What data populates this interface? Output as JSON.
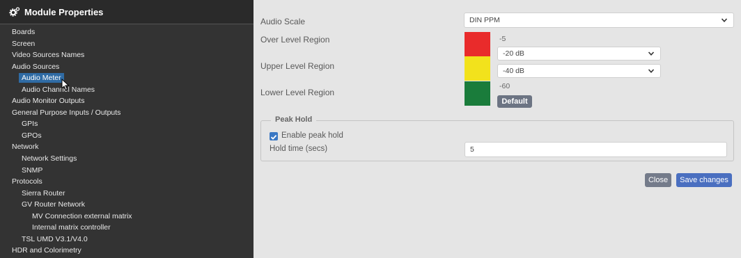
{
  "sidebar": {
    "title": "Module Properties",
    "items": [
      {
        "label": "Boards"
      },
      {
        "label": "Screen"
      },
      {
        "label": "Video Sources Names"
      },
      {
        "label": "Audio Sources"
      },
      {
        "label": "Audio Meter",
        "selected": true
      },
      {
        "label": "Audio Channel Names"
      },
      {
        "label": "Audio Monitor Outputs"
      },
      {
        "label": "General Purpose Inputs / Outputs"
      },
      {
        "label": "GPIs"
      },
      {
        "label": "GPOs"
      },
      {
        "label": "Network"
      },
      {
        "label": "Network Settings"
      },
      {
        "label": "SNMP"
      },
      {
        "label": "Protocols"
      },
      {
        "label": "Sierra Router"
      },
      {
        "label": "GV Router Network"
      },
      {
        "label": "MV Connection external matrix"
      },
      {
        "label": "Internal matrix controller"
      },
      {
        "label": "TSL UMD V3.1/V4.0"
      },
      {
        "label": "HDR and Colorimetry"
      }
    ]
  },
  "main": {
    "audio_scale": {
      "label": "Audio Scale",
      "value": "DIN PPM"
    },
    "over_level": {
      "label": "Over Level Region",
      "value": "-5",
      "color": "#e92b2b"
    },
    "upper_level": {
      "label": "Upper Level Region",
      "select_top": "-20 dB",
      "select_bottom": "-40 dB",
      "color": "#f2e21c"
    },
    "lower_level": {
      "label": "Lower Level Region",
      "value": "-60",
      "color": "#1a7c3b"
    },
    "default_button": "Default",
    "peak_hold": {
      "legend": "Peak Hold",
      "enable_label": "Enable peak hold",
      "enabled": true,
      "hold_time_label": "Hold time (secs)",
      "hold_time_value": "5"
    },
    "close_button": "Close",
    "save_button": "Save changes"
  },
  "colors": {
    "sidebar_bg": "#333333",
    "selected_bg": "#2f6ba4",
    "default_btn": "#6c7483",
    "close_btn": "#747b8a",
    "save_btn": "#4a6fc0",
    "checkbox": "#3a78c4"
  }
}
